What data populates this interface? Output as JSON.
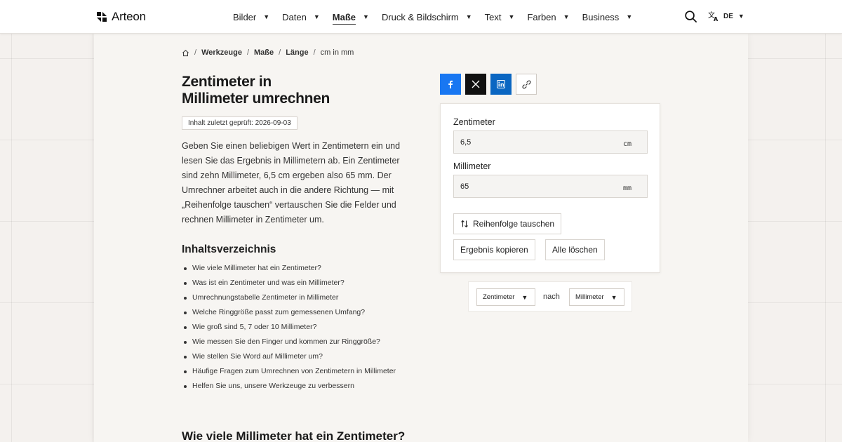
{
  "brand": {
    "name": "Arteon"
  },
  "nav": {
    "items": [
      {
        "label": "Bilder"
      },
      {
        "label": "Daten"
      },
      {
        "label": "Maße",
        "active": true
      },
      {
        "label": "Druck & Bildschirm"
      },
      {
        "label": "Text"
      },
      {
        "label": "Farben"
      },
      {
        "label": "Business"
      }
    ],
    "caret": "▼",
    "lang_code": "DE"
  },
  "breadcrumb": {
    "items": [
      "Werkzeuge",
      "Maße",
      "Länge",
      "cm in mm"
    ],
    "sep": "/"
  },
  "page": {
    "title_line1": "Zentimeter in",
    "title_line2": "Millimeter umrechnen",
    "badge": "Inhalt zuletzt geprüft: 2026-09-03",
    "intro": "Geben Sie einen beliebigen Wert in Zentimetern ein und lesen Sie das Ergebnis in Millimetern ab. Ein Zentimeter sind zehn Millimeter, 6,5 cm ergeben also 65 mm. Der Umrechner arbeitet auch in die andere Richtung — mit „Reihenfolge tauschen“ vertauschen Sie die Felder und rechnen Millimeter in Zentimeter um.",
    "toc_title": "Inhaltsverzeichnis",
    "toc": [
      "Wie viele Millimeter hat ein Zentimeter?",
      "Was ist ein Zentimeter und was ein Millimeter?",
      "Umrechnungstabelle Zentimeter in Millimeter",
      "Welche Ringgröße passt zum gemessenen Umfang?",
      "Wie groß sind 5, 7 oder 10 Millimeter?",
      "Wie messen Sie den Finger und kommen zur Ringgröße?",
      "Wie stellen Sie Word auf Millimeter um?",
      "Häufige Fragen zum Umrechnen von Zentimetern in Millimeter",
      "Helfen Sie uns, unsere Werkzeuge zu verbessern"
    ],
    "section_heading": "Wie viele Millimeter hat ein Zentimeter?"
  },
  "converter": {
    "from_label": "Zentimeter",
    "from_value": "6,5",
    "from_unit": "cm",
    "to_label": "Millimeter",
    "to_value": "65",
    "to_unit": "mm",
    "swap_label": "Reihenfolge tauschen",
    "copy_label": "Ergebnis kopieren",
    "clear_label": "Alle löschen"
  },
  "unit_selector": {
    "from": "Zentimeter",
    "connector": "nach",
    "to": "Millimeter"
  },
  "colors": {
    "facebook": "#1877f2",
    "x": "#111111",
    "linkedin": "#0a66c2"
  }
}
